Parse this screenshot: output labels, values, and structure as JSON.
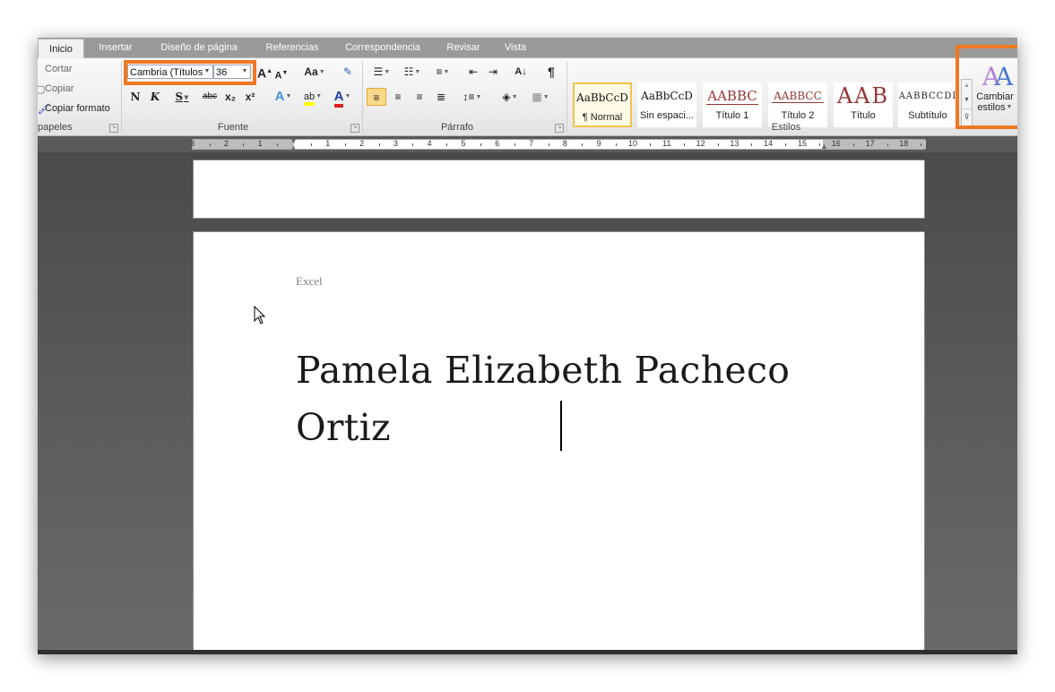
{
  "tabs": [
    "Inicio",
    "Insertar",
    "Diseño de página",
    "Referencias",
    "Correspondencia",
    "Revisar",
    "Vista"
  ],
  "active_tab": "Inicio",
  "clipboard": {
    "cut_label": "Cortar",
    "copy_label": "Copiar",
    "format_painter_label": "Copiar formato",
    "group_label": "papeles"
  },
  "font": {
    "family": "Cambria (Títulos",
    "size": "36",
    "group_label": "Fuente",
    "bold": "N",
    "italic": "K",
    "underline": "S",
    "strike": "abc",
    "subscript": "x₂",
    "superscript": "x²",
    "grow": "A",
    "shrink": "A",
    "change_case": "Aa"
  },
  "paragraph": {
    "group_label": "Párrafo",
    "show_marks": "¶"
  },
  "styles": {
    "group_label": "Estilos",
    "items": [
      {
        "sample": "AaBbCcD",
        "name": "¶ Normal"
      },
      {
        "sample": "AaBbCcD",
        "name": "Sin espaci..."
      },
      {
        "sample": "AABBC",
        "name": "Título 1"
      },
      {
        "sample": "AABBCC",
        "name": "Título 2"
      },
      {
        "sample": "AAB",
        "name": "Título"
      },
      {
        "sample": "AABBCCDI",
        "name": "Subtítulo"
      }
    ],
    "change_styles_line1": "Cambiar",
    "change_styles_line2": "estilos"
  },
  "ruler_numbers": [
    "3",
    "2",
    "1",
    "1",
    "2",
    "3",
    "4",
    "5",
    "6",
    "7",
    "8",
    "9",
    "10",
    "11",
    "12",
    "13",
    "14",
    "15",
    "16",
    "17",
    "18"
  ],
  "document": {
    "header": "Excel",
    "title_line1": "Pamela Elizabeth Pacheco",
    "title_line2": "Ortiz"
  },
  "colors": {
    "highlight": "#f07822",
    "title_style": "#943634",
    "selected_style_border": "#f1c34f"
  }
}
